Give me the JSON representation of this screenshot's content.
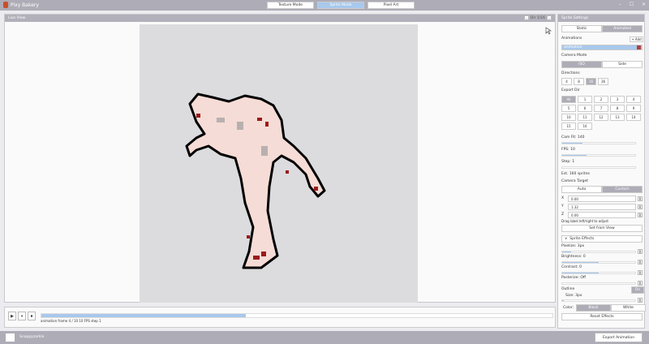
{
  "app": {
    "title": "Pixy Bakery",
    "modes": [
      "Texture Mode",
      "Sprite Mode",
      "Pixel Art"
    ],
    "active_mode": 1,
    "window_buttons": [
      "–",
      "☐",
      "×"
    ]
  },
  "viewport": {
    "title": "Live View",
    "dir_label": "Dir 1/16",
    "prev": "‹",
    "next": "›"
  },
  "controls": {
    "buttons": [
      "▶",
      "⏸",
      "⏹"
    ],
    "progress": 0.4,
    "status": "animation  frame 4 / 10  10 FPS  step 1"
  },
  "footer": {
    "user": "Snappyzorkle",
    "export_label": "Export Animation"
  },
  "sprite_settings": {
    "title": "Sprite Settings",
    "type_options": [
      "Static",
      "Animated"
    ],
    "type_selected": 1,
    "animations_label": "Animations",
    "add_label": "+ Add",
    "animation_selected": "animation",
    "camera_mode_label": "Camera Mode",
    "camera_modes": [
      "ISO",
      "Side"
    ],
    "camera_mode_selected": 0,
    "directions_label": "Directions",
    "directions": [
      "4",
      "8",
      "16",
      "36"
    ],
    "directions_selected": 2,
    "export_dir_label": "Export Dir",
    "export_dirs": [
      "All",
      "1",
      "2",
      "3",
      "4",
      "5",
      "6",
      "7",
      "8",
      "9",
      "10",
      "11",
      "12",
      "13",
      "14",
      "15",
      "16"
    ],
    "export_dir_selected": 0,
    "cam_fit_label": "Cam Fit: 140",
    "cam_fit": 0.28,
    "fps_label": "FPS: 10",
    "fps": 0.33,
    "step_label": "Step: 1",
    "step": 0,
    "estimate": "Est. 160 sprites",
    "camera_target_label": "Camera Target",
    "target_options": [
      "Auto",
      "Custom"
    ],
    "target_selected": 1,
    "axes": [
      {
        "label": "X",
        "value": "0.00"
      },
      {
        "label": "Y",
        "value": "1.32"
      },
      {
        "label": "Z",
        "value": "0.00"
      }
    ],
    "reset_glyph": "R",
    "drag_hint": "Drag label left/right to adjust",
    "set_from_view": "Set from View",
    "effects_label": "Sprite Effects",
    "effects_toggle": "∨",
    "pixelize_label": "Pixelize: 3px",
    "pixelize": 0.12,
    "brightness_label": "Brightness: 0",
    "brightness": 0.5,
    "contrast_label": "Contrast: 0",
    "contrast": 0.5,
    "posterize_label": "Posterize: Off",
    "posterize": 0,
    "outline_label": "Outline",
    "outline_toggle": "On",
    "size_label": "Size: 3px",
    "size": 0.02,
    "color_label": "Color:",
    "colors": [
      "Black",
      "White"
    ],
    "color_selected": 0,
    "reset_effects": "Reset Effects"
  }
}
